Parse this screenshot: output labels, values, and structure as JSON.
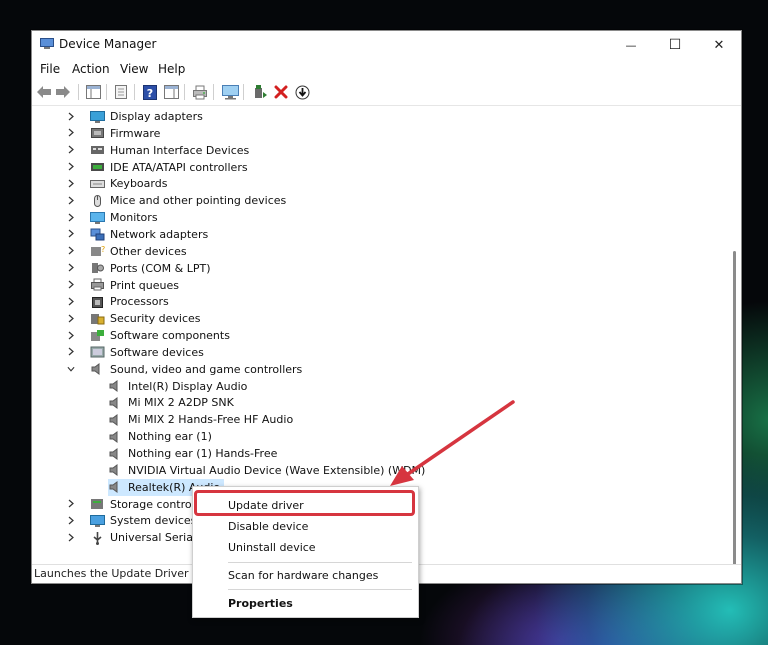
{
  "window": {
    "title": "Device Manager",
    "controls": {
      "minimize": "—",
      "maximize": "☐",
      "close": "✕"
    }
  },
  "menu": [
    "File",
    "Action",
    "View",
    "Help"
  ],
  "tree": {
    "categories": [
      {
        "label": "Display adapters",
        "icon": "display-adapter-icon",
        "expanded": false
      },
      {
        "label": "Firmware",
        "icon": "firmware-icon",
        "expanded": false
      },
      {
        "label": "Human Interface Devices",
        "icon": "hid-icon",
        "expanded": false
      },
      {
        "label": "IDE ATA/ATAPI controllers",
        "icon": "ide-controller-icon",
        "expanded": false
      },
      {
        "label": "Keyboards",
        "icon": "keyboard-icon",
        "expanded": false
      },
      {
        "label": "Mice and other pointing devices",
        "icon": "mouse-icon",
        "expanded": false
      },
      {
        "label": "Monitors",
        "icon": "monitor-icon",
        "expanded": false
      },
      {
        "label": "Network adapters",
        "icon": "network-adapter-icon",
        "expanded": false
      },
      {
        "label": "Other devices",
        "icon": "other-devices-icon",
        "expanded": false
      },
      {
        "label": "Ports (COM & LPT)",
        "icon": "ports-icon",
        "expanded": false
      },
      {
        "label": "Print queues",
        "icon": "printer-icon",
        "expanded": false
      },
      {
        "label": "Processors",
        "icon": "processor-icon",
        "expanded": false
      },
      {
        "label": "Security devices",
        "icon": "security-device-icon",
        "expanded": false
      },
      {
        "label": "Software components",
        "icon": "software-component-icon",
        "expanded": false
      },
      {
        "label": "Software devices",
        "icon": "software-device-icon",
        "expanded": false
      },
      {
        "label": "Sound, video and game controllers",
        "icon": "speaker-icon",
        "expanded": true
      }
    ],
    "sound_children": [
      "Intel(R) Display Audio",
      "Mi MIX 2 A2DP SNK",
      "Mi MIX 2 Hands-Free HF Audio",
      "Nothing ear (1)",
      "Nothing ear (1) Hands-Free",
      "NVIDIA Virtual Audio Device (Wave Extensible) (WDM)",
      "Realtek(R) Audio"
    ],
    "selected": "Realtek(R) Audio",
    "after": [
      {
        "label": "Storage controllers",
        "icon": "storage-controller-icon"
      },
      {
        "label": "System devices",
        "icon": "system-device-icon"
      },
      {
        "label": "Universal Serial Bus c",
        "icon": "usb-icon"
      }
    ]
  },
  "context_menu": {
    "update": "Update driver",
    "disable": "Disable device",
    "uninstall": "Uninstall device",
    "scan": "Scan for hardware changes",
    "properties": "Properties"
  },
  "status": "Launches the Update Driver Wizard",
  "colors": {
    "highlight": "#d6353f",
    "selection": "#cde8ff"
  }
}
